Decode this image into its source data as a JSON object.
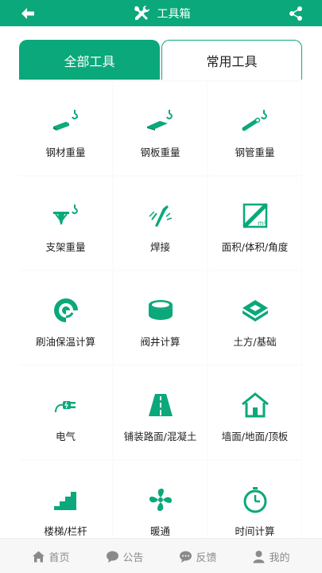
{
  "header": {
    "title": "工具箱"
  },
  "tabs": [
    {
      "label": "全部工具",
      "active": true
    },
    {
      "label": "常用工具",
      "active": false
    }
  ],
  "tools": [
    {
      "label": "钢材重量",
      "icon": "steel-bar-hook-icon"
    },
    {
      "label": "钢板重量",
      "icon": "steel-plate-hook-icon"
    },
    {
      "label": "钢管重量",
      "icon": "steel-pipe-hook-icon"
    },
    {
      "label": "支架重量",
      "icon": "bracket-hook-icon"
    },
    {
      "label": "焊接",
      "icon": "welding-icon"
    },
    {
      "label": "面积/体积/角度",
      "icon": "measure-area-icon"
    },
    {
      "label": "刷油保温计算",
      "icon": "paint-insulation-icon"
    },
    {
      "label": "阀井计算",
      "icon": "valve-well-icon"
    },
    {
      "label": "土方/基础",
      "icon": "earthwork-icon"
    },
    {
      "label": "电气",
      "icon": "electric-plug-icon"
    },
    {
      "label": "铺装路面/混凝土",
      "icon": "road-icon"
    },
    {
      "label": "墙面/地面/顶板",
      "icon": "house-icon"
    },
    {
      "label": "楼梯/栏杆",
      "icon": "stairs-icon"
    },
    {
      "label": "暖通",
      "icon": "fan-icon"
    },
    {
      "label": "时间计算",
      "icon": "stopwatch-icon"
    }
  ],
  "nav": [
    {
      "label": "首页",
      "icon": "home-icon"
    },
    {
      "label": "公告",
      "icon": "chat-bubble-icon"
    },
    {
      "label": "反馈",
      "icon": "feedback-icon"
    },
    {
      "label": "我的",
      "icon": "user-icon"
    }
  ],
  "colors": {
    "accent": "#0aa87a",
    "nav_text": "#8a8a8a"
  }
}
